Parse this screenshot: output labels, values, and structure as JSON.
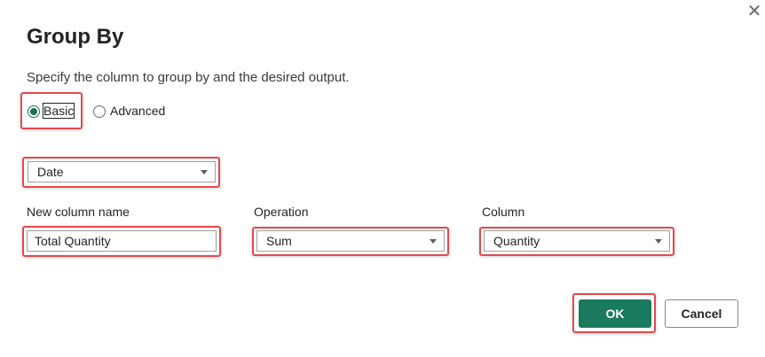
{
  "dialog": {
    "title": "Group By",
    "description": "Specify the column to group by and the desired output.",
    "close_icon": "close-icon",
    "accent_color": "#1a7a5e",
    "highlight_color": "#e5484d"
  },
  "mode": {
    "options": [
      {
        "label": "Basic",
        "selected": true
      },
      {
        "label": "Advanced",
        "selected": false
      }
    ]
  },
  "group_by": {
    "selected": "Date"
  },
  "aggregation": {
    "new_column_label": "New column name",
    "new_column_value": "Total Quantity",
    "operation_label": "Operation",
    "operation_value": "Sum",
    "column_label": "Column",
    "column_value": "Quantity"
  },
  "footer": {
    "ok_label": "OK",
    "cancel_label": "Cancel"
  }
}
